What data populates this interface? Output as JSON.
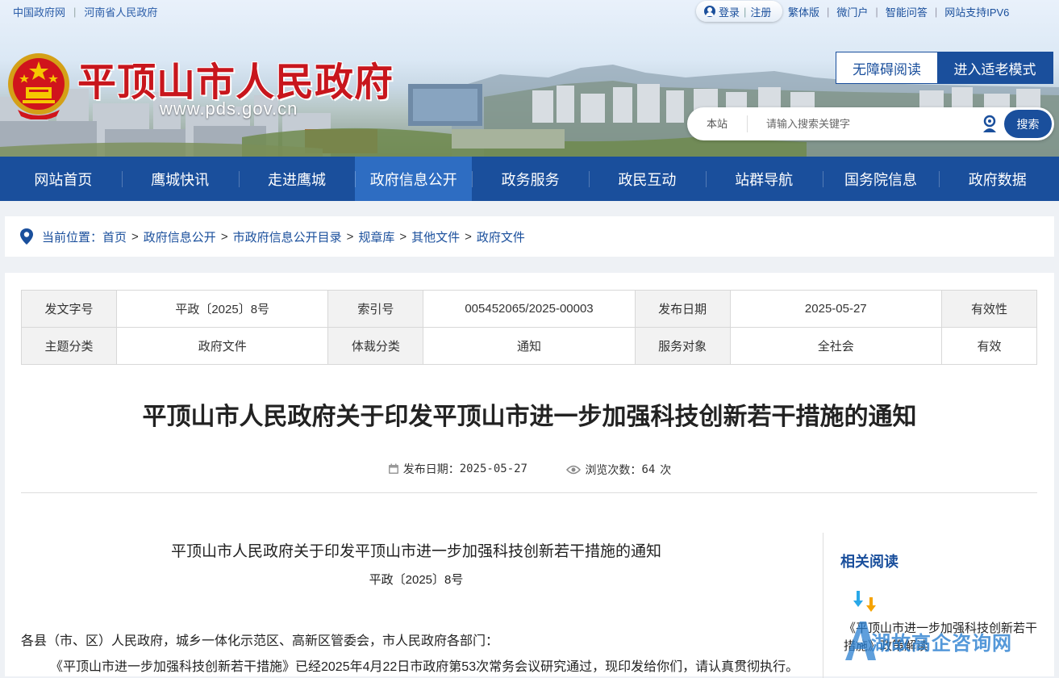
{
  "top_links": [
    "中国政府网",
    "河南省人民政府"
  ],
  "user": {
    "login": "登录",
    "sep": "|",
    "register": "注册"
  },
  "right_links": [
    "繁体版",
    "微门户",
    "智能问答",
    "网站支持IPV6"
  ],
  "site": {
    "title": "平顶山市人民政府",
    "url": "www.pds.gov.cn"
  },
  "accessibility": {
    "barrier_free": "无障碍阅读",
    "elder_mode": "进入适老模式"
  },
  "search": {
    "scope": "本站",
    "placeholder": "请输入搜索关键字",
    "button": "搜索"
  },
  "nav": [
    "网站首页",
    "鹰城快讯",
    "走进鹰城",
    "政府信息公开",
    "政务服务",
    "政民互动",
    "站群导航",
    "国务院信息",
    "政府数据"
  ],
  "nav_active_index": 3,
  "breadcrumb": {
    "label": "当前位置：",
    "items": [
      "首页",
      "政府信息公开",
      "市政府信息公开目录",
      "规章库",
      "其他文件",
      "政府文件"
    ],
    "sep": ">"
  },
  "meta_table": {
    "row1": [
      "发文字号",
      "平政〔2025〕8号",
      "索引号",
      "005452065/2025-00003",
      "发布日期",
      "2025-05-27",
      "有效性"
    ],
    "row2": [
      "主题分类",
      "政府文件",
      "体裁分类",
      "通知",
      "服务对象",
      "全社会",
      "有效"
    ]
  },
  "article": {
    "title": "平顶山市人民政府关于印发平顶山市进一步加强科技创新若干措施的通知",
    "publish_label": "发布日期：",
    "publish_date": "2025-05-27",
    "views_label": "浏览次数：",
    "views": "64",
    "views_unit": "次",
    "body_title": "平顶山市人民政府关于印发平顶山市进一步加强科技创新若干措施的通知",
    "doc_no": "平政〔2025〕8号",
    "para1": "各县（市、区）人民政府，城乡一体化示范区、高新区管委会，市人民政府各部门：",
    "para2": "《平顶山市进一步加强科技创新若干措施》已经2025年4月22日市政府第53次常务会议研究通过，现印发给你们，请认真贯彻执行。"
  },
  "sidebar": {
    "heading": "相关阅读",
    "item": "《平顶山市进一步加强科技创新若干措施》政策解读"
  },
  "watermark": {
    "text": "湖故高企咨询网"
  },
  "colors": {
    "primary": "#1a4f9c",
    "nav_active": "#2e6dc2",
    "title_red": "#c8161d"
  }
}
